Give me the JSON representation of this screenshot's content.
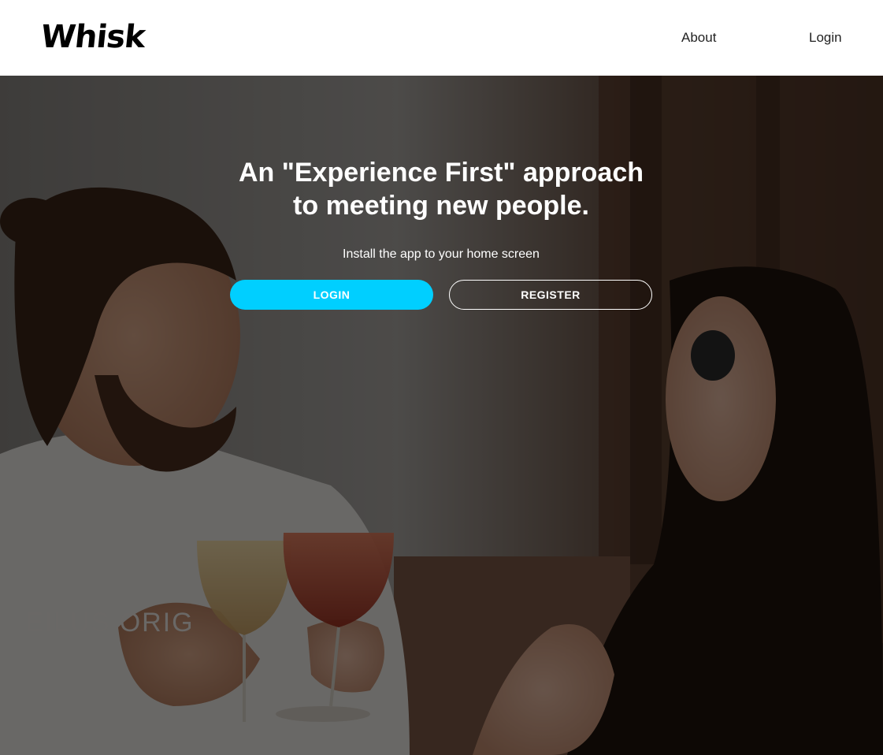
{
  "header": {
    "logo": "Whisk",
    "nav": {
      "about": "About",
      "login": "Login"
    }
  },
  "hero": {
    "title_line1": "An \"Experience First\" approach",
    "title_line2": "to meeting new people.",
    "subtitle": "Install the app to your home screen",
    "login_button": "LOGIN",
    "register_button": "REGISTER",
    "photo_shirt_text": "EILUS ORIG"
  },
  "colors": {
    "accent": "#00cfff",
    "header_bg": "#ffffff",
    "hero_overlay": "#000000"
  }
}
